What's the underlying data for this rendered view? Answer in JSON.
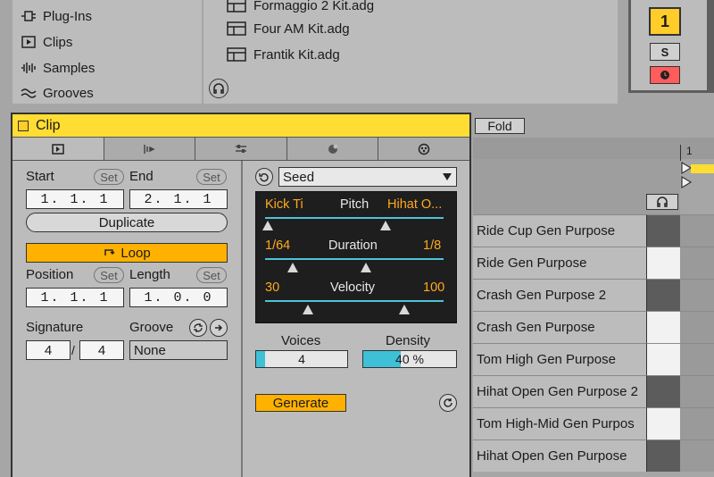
{
  "browser": {
    "places": [
      {
        "label": "Plug-Ins",
        "icon": "plugin-icon"
      },
      {
        "label": "Clips",
        "icon": "clip-icon"
      },
      {
        "label": "Samples",
        "icon": "waveform-icon"
      },
      {
        "label": "Grooves",
        "icon": "groove-icon"
      }
    ],
    "files": [
      "Formaggio 2 Kit.adg",
      "Four AM Kit.adg",
      "Frantik Kit.adg"
    ]
  },
  "mixer": {
    "track_number": "1",
    "solo_label": "S"
  },
  "clip": {
    "title": "Clip",
    "start_label": "Start",
    "end_label": "End",
    "set_label": "Set",
    "start_value": "1. 1. 1",
    "end_value": "2. 1. 1",
    "duplicate_label": "Duplicate",
    "loop_label": "Loop",
    "position_label": "Position",
    "length_label": "Length",
    "position_value": "1. 1. 1",
    "length_value": "1. 0. 0",
    "signature_label": "Signature",
    "groove_label": "Groove",
    "sig_num": "4",
    "sig_sep": "/",
    "sig_den": "4",
    "groove_value": "None"
  },
  "generator": {
    "seed_label": "Seed",
    "pitch_label": "Pitch",
    "pitch_low": "Kick Ti",
    "pitch_high": "Hihat O...",
    "duration_label": "Duration",
    "duration_low": "1/64",
    "duration_high": "1/8",
    "velocity_label": "Velocity",
    "velocity_low": "30",
    "velocity_high": "100",
    "voices_label": "Voices",
    "voices_value": "4",
    "voices_fill": 0.1,
    "density_label": "Density",
    "density_value": "40 %",
    "density_fill": 0.4,
    "generate_label": "Generate"
  },
  "rack": {
    "fold_label": "Fold",
    "ruler_label": "1",
    "pads": [
      {
        "name": "Ride Cup Gen Purpose",
        "shade": "dark"
      },
      {
        "name": "Ride Gen Purpose",
        "shade": "light"
      },
      {
        "name": "Crash Gen Purpose 2",
        "shade": "dark"
      },
      {
        "name": "Crash Gen Purpose",
        "shade": "light"
      },
      {
        "name": "Tom High Gen Purpose",
        "shade": "light"
      },
      {
        "name": "Hihat Open Gen Purpose 2",
        "shade": "dark"
      },
      {
        "name": "Tom High-Mid Gen Purpos",
        "shade": "light"
      },
      {
        "name": "Hihat Open Gen Purpose",
        "shade": "dark"
      }
    ]
  },
  "colors": {
    "clip_header": "#ffdd33",
    "orange": "#ffb100",
    "cyan": "#4fc3d7",
    "value_orange": "#ffaa1f"
  }
}
